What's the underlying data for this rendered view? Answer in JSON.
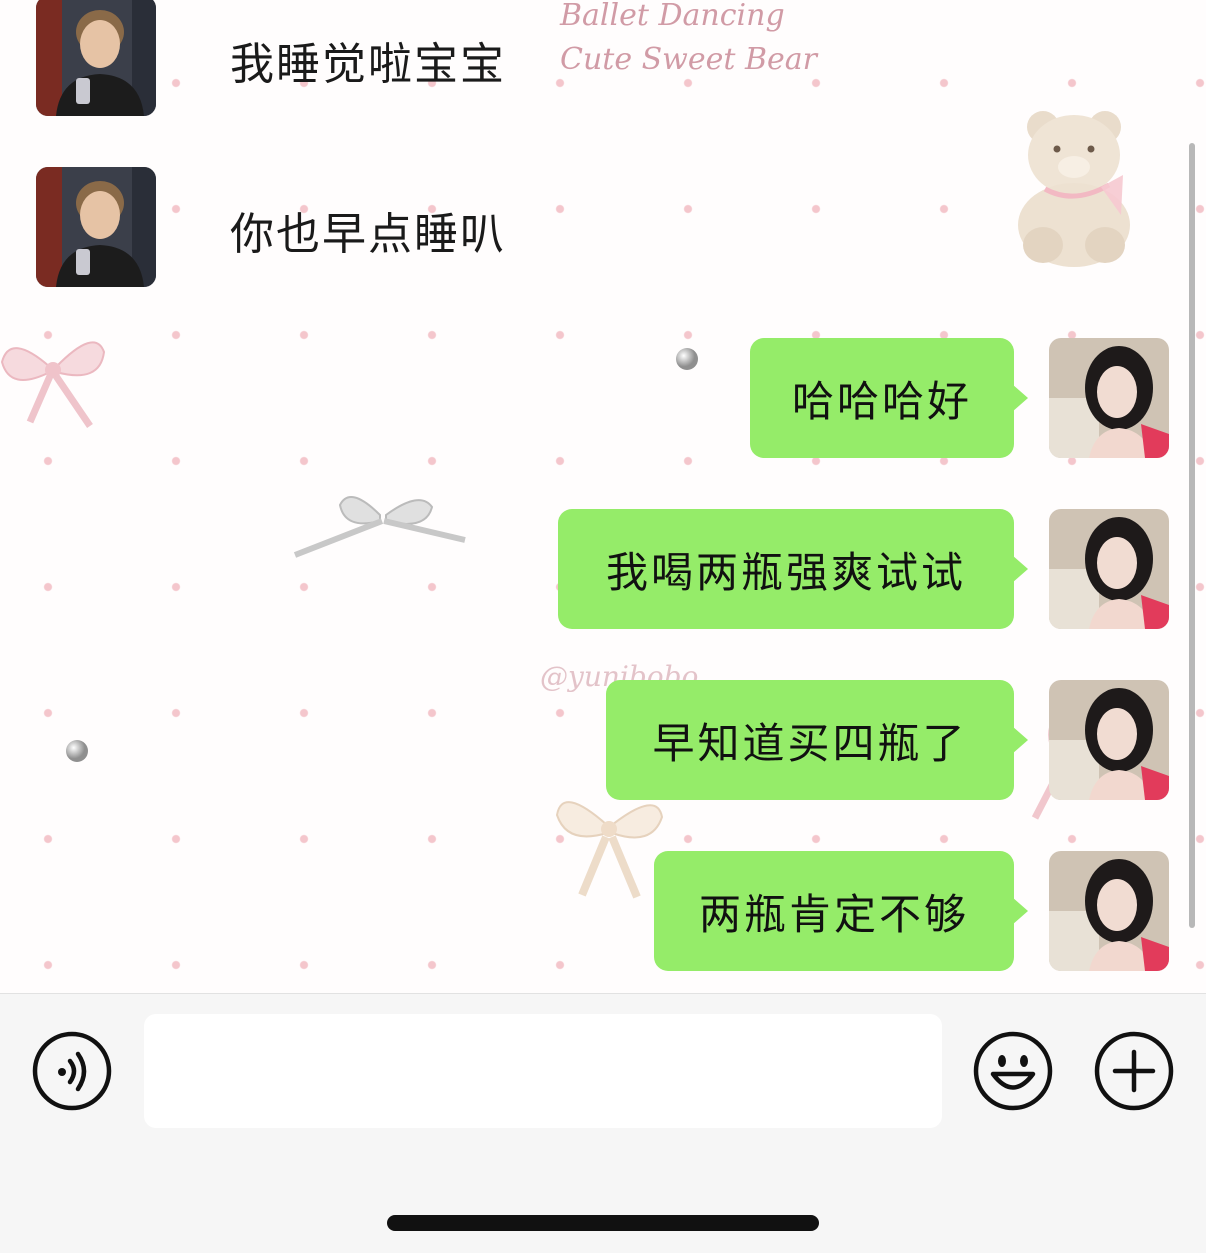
{
  "wallpaper": {
    "title_line1": "Ballet Dancing",
    "title_line2": "Cute Sweet Bear",
    "handle": "@yunibobo"
  },
  "conversation": {
    "incoming": [
      {
        "avatar": "contact-avatar",
        "text": "我睡觉啦宝宝"
      },
      {
        "avatar": "contact-avatar",
        "text": "你也早点睡叭"
      }
    ],
    "outgoing": [
      {
        "avatar": "self-avatar",
        "text": "哈哈哈好"
      },
      {
        "avatar": "self-avatar",
        "text": "我喝两瓶强爽试试"
      },
      {
        "avatar": "self-avatar",
        "text": "早知道买四瓶了"
      },
      {
        "avatar": "self-avatar",
        "text": "两瓶肯定不够"
      }
    ]
  },
  "input_bar": {
    "message_value": "",
    "voice_icon": "voice-icon",
    "emoji_icon": "emoji-icon",
    "more_icon": "plus-icon"
  },
  "colors": {
    "outgoing_bubble": "#95ec69",
    "wallpaper_dots": "#f4c6cc",
    "input_bar_bg": "#f6f6f6"
  }
}
